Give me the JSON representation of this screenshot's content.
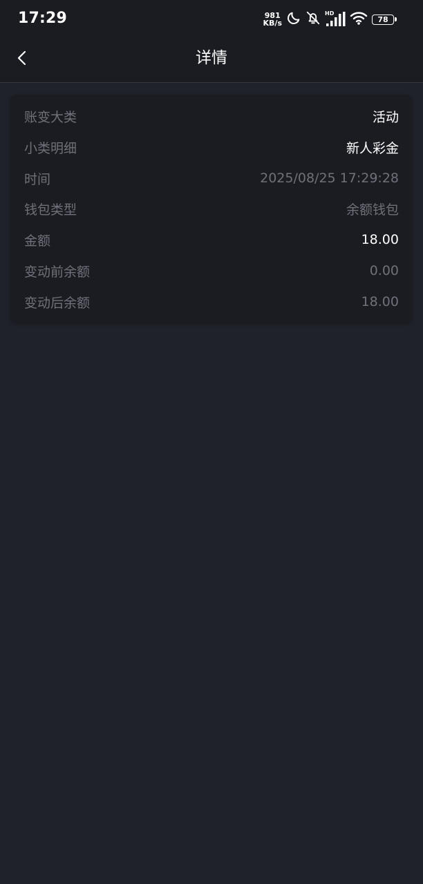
{
  "status_bar": {
    "time": "17:29",
    "net_speed_value": "981",
    "net_speed_unit": "KB/s",
    "hd_label": "HD",
    "battery_level": "78",
    "icons": [
      "moon-icon",
      "bell-off-icon",
      "signal-icon",
      "wifi-icon",
      "battery-icon"
    ]
  },
  "header": {
    "title": "详情",
    "back_icon": "chevron-left-icon"
  },
  "details": [
    {
      "label": "账变大类",
      "value": "活动",
      "highlight": true
    },
    {
      "label": "小类明细",
      "value": "新人彩金",
      "highlight": true
    },
    {
      "label": "时间",
      "value": "2025/08/25 17:29:28",
      "highlight": false
    },
    {
      "label": "钱包类型",
      "value": "余额钱包",
      "highlight": false
    },
    {
      "label": "金额",
      "value": "18.00",
      "highlight": true
    },
    {
      "label": "变动前余额",
      "value": "0.00",
      "highlight": false
    },
    {
      "label": "变动后余额",
      "value": "18.00",
      "highlight": false
    }
  ],
  "colors": {
    "background": "#20222b",
    "card": "#1b1c22",
    "muted_text": "#6f717a",
    "bright_text": "#ffffff"
  }
}
